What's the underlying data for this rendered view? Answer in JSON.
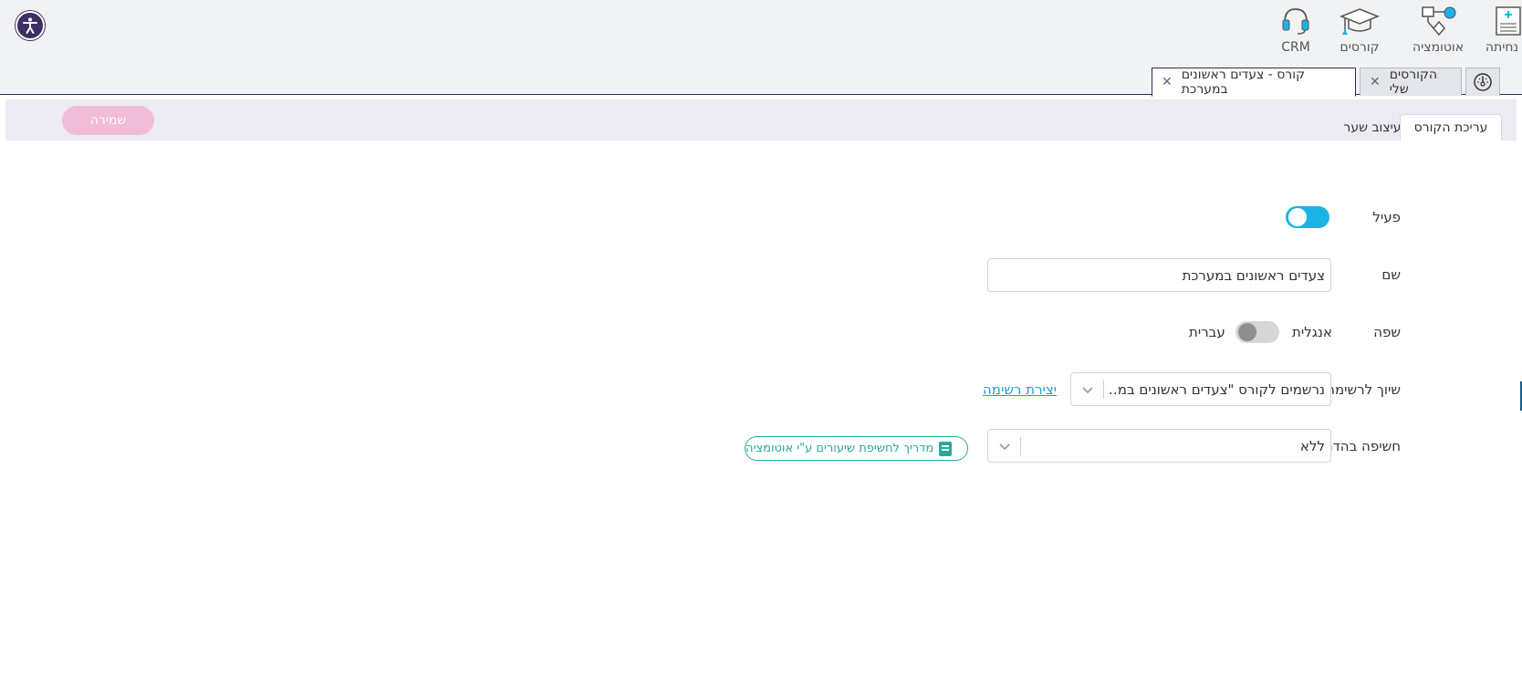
{
  "nav": {
    "items": [
      {
        "label": "נחיתה",
        "icon": "landing-page-icon"
      },
      {
        "label": "אוטומציה",
        "icon": "automation-icon"
      },
      {
        "label": "קורסים",
        "icon": "graduation-cap-icon"
      },
      {
        "label": "CRM",
        "icon": "headset-icon"
      }
    ]
  },
  "window_tabs": [
    {
      "label": "קורס - צעדים ראשונים במערכת",
      "active": true
    },
    {
      "label": "הקורסים שלי",
      "active": false
    },
    {
      "icon": "dashboard-icon"
    }
  ],
  "subtabs": {
    "edit_course": "עריכת הקורס",
    "cover_design": "עיצוב שער"
  },
  "save_label": "שמירה",
  "form": {
    "active_label": "פעיל",
    "active_value": true,
    "name_label": "שם",
    "name_value": "צעדים ראשונים במערכת",
    "language_label": "שפה",
    "language_left": "עברית",
    "language_right": "אנגלית",
    "list_label": "שיוך לרשימה",
    "list_value": "נרשמים לקורס \"צעדים ראשונים במ…",
    "create_list_link": "יצירת רשימה",
    "drip_label": "חשיפה בהדרגה לפי",
    "drip_value": "ללא",
    "guide_label": "מדריך לחשיפת שיעורים ע\"י אוטומציה"
  },
  "colors": {
    "brand_dark": "#3d2f63",
    "toggle_on": "#1bb3e6",
    "save_pink": "#f1bcd8",
    "teal": "#2aa99b",
    "link": "#18a3d8"
  }
}
